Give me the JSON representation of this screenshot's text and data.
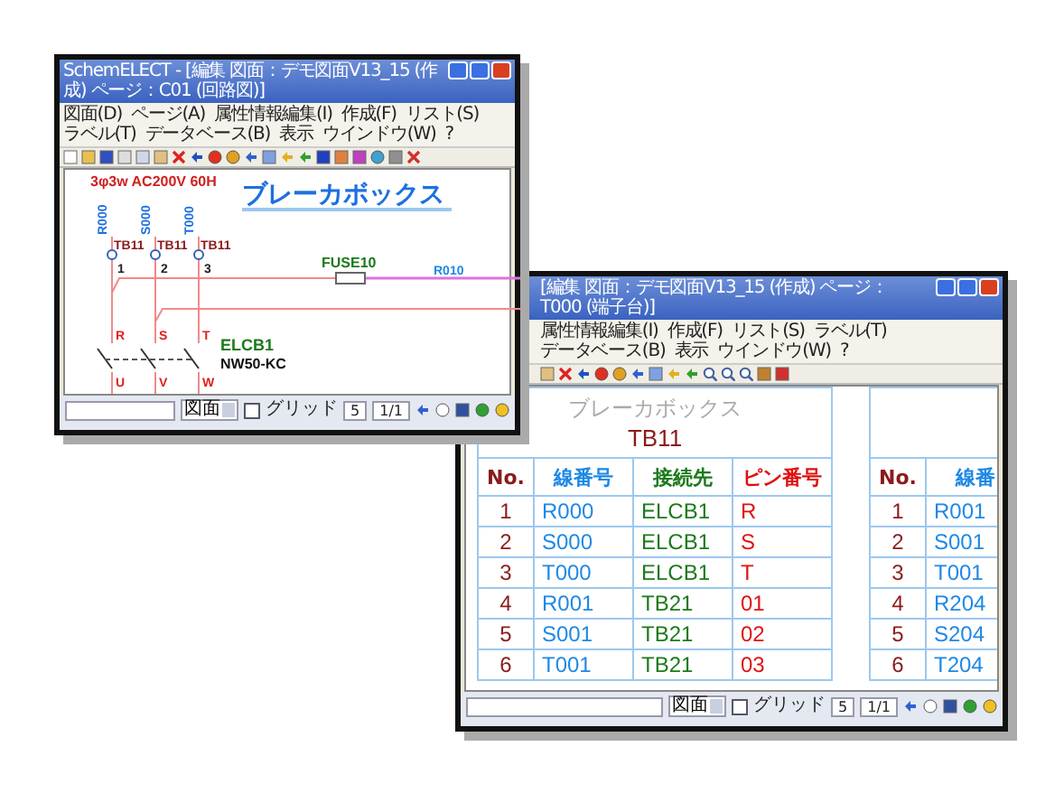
{
  "schematic_window": {
    "title": "SchemELECT - [編集 図面：デモ図面V13_15 (作成) ページ：C01 (回路図)]",
    "menu": [
      "図面(D)",
      "ページ(A)",
      "属性情報編集(I)",
      "作成(F)",
      "リスト(S)",
      "ラベル(T)",
      "データベース(B)",
      "表示",
      "ウインドウ(W)",
      "?"
    ],
    "drawing": {
      "title": "ブレーカボックス",
      "supply": "3φ3w AC200V 60H",
      "lines": [
        {
          "wire": "R000",
          "terminal": "TB11",
          "pin": "1",
          "phase_in": "R",
          "phase_out": "U"
        },
        {
          "wire": "S000",
          "terminal": "TB11",
          "pin": "2",
          "phase_in": "S",
          "phase_out": "V"
        },
        {
          "wire": "T000",
          "terminal": "TB11",
          "pin": "3",
          "phase_in": "T",
          "phase_out": "W"
        }
      ],
      "fuse": {
        "name": "FUSE10",
        "wire": "R010"
      },
      "breaker": {
        "name": "ELCB1",
        "model": "NW50-KC"
      }
    },
    "status_bar": {
      "view": "図面",
      "grid_label": "グリッド",
      "grid_checked": false,
      "scale": "5",
      "page": "1/1"
    }
  },
  "table_window": {
    "title": "[編集 図面：デモ図面V13_15 (作成) ページ：T000 (端子台)]",
    "menu": [
      "属性情報編集(I)",
      "作成(F)",
      "リスト(S)",
      "ラベル(T)",
      "データベース(B)",
      "表示",
      "ウインドウ(W)",
      "?"
    ],
    "tables": [
      {
        "heading": "ブレーカボックス",
        "name": "TB11",
        "columns": [
          {
            "label": "No.",
            "color": "#8b1a1a"
          },
          {
            "label": "線番号",
            "color": "#1e88e5"
          },
          {
            "label": "接続先",
            "color": "#1b7a1b"
          },
          {
            "label": "ピン番号",
            "color": "#e01010"
          }
        ],
        "rows": [
          [
            "1",
            "R000",
            "ELCB1",
            "R"
          ],
          [
            "2",
            "S000",
            "ELCB1",
            "S"
          ],
          [
            "3",
            "T000",
            "ELCB1",
            "T"
          ],
          [
            "4",
            "R001",
            "TB21",
            "01"
          ],
          [
            "5",
            "S001",
            "TB21",
            "02"
          ],
          [
            "6",
            "T001",
            "TB21",
            "03"
          ]
        ]
      },
      {
        "columns": [
          {
            "label": "No.",
            "color": "#8b1a1a"
          },
          {
            "label": "線番",
            "color": "#1e88e5"
          }
        ],
        "rows": [
          [
            "1",
            "R001"
          ],
          [
            "2",
            "S001"
          ],
          [
            "3",
            "T001"
          ],
          [
            "4",
            "R204"
          ],
          [
            "5",
            "S204"
          ],
          [
            "6",
            "T204"
          ]
        ]
      }
    ],
    "status_bar": {
      "view": "図面",
      "grid_label": "グリッド",
      "grid_checked": false,
      "scale": "5",
      "page": "1/1"
    }
  }
}
